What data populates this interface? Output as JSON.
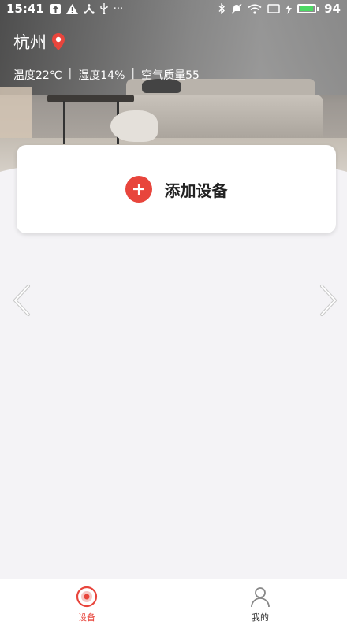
{
  "status_bar": {
    "time": "15:41",
    "battery_level": "94"
  },
  "header": {
    "city": "杭州",
    "temperature": "温度22℃",
    "humidity": "湿度14%",
    "air_quality": "空气质量55",
    "separator": "|"
  },
  "card": {
    "add_device_label": "添加设备"
  },
  "tabs": [
    {
      "label": "设备",
      "active": true,
      "icon": "device-icon"
    },
    {
      "label": "我的",
      "active": false,
      "icon": "profile-icon"
    }
  ],
  "colors": {
    "accent": "#e8453c",
    "background": "#f4f3f6"
  }
}
